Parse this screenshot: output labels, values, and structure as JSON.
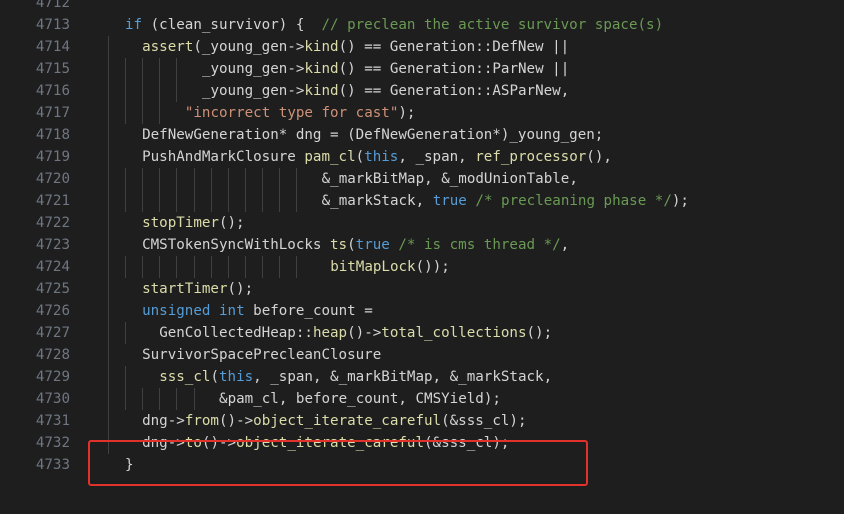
{
  "editor": {
    "first_line": 4712,
    "lines": [
      {
        "num": "4712",
        "indent": 0,
        "tokens": []
      },
      {
        "num": "4713",
        "indent": 0,
        "tokens": [
          {
            "t": "kw",
            "v": "if"
          },
          {
            "t": "plain",
            "v": " (clean_survivor) {  "
          },
          {
            "t": "cm",
            "v": "// preclean the active survivor space(s)"
          }
        ]
      },
      {
        "num": "4714",
        "indent": 2,
        "tokens": [
          {
            "t": "fn",
            "v": "assert"
          },
          {
            "t": "plain",
            "v": "(_young_gen->"
          },
          {
            "t": "fn",
            "v": "kind"
          },
          {
            "t": "plain",
            "v": "() == Generation::DefNew ||"
          }
        ]
      },
      {
        "num": "4715",
        "indent": 9,
        "tokens": [
          {
            "t": "plain",
            "v": "_young_gen->"
          },
          {
            "t": "fn",
            "v": "kind"
          },
          {
            "t": "plain",
            "v": "() == Generation::ParNew ||"
          }
        ]
      },
      {
        "num": "4716",
        "indent": 9,
        "tokens": [
          {
            "t": "plain",
            "v": "_young_gen->"
          },
          {
            "t": "fn",
            "v": "kind"
          },
          {
            "t": "plain",
            "v": "() == Generation::ASParNew,"
          }
        ]
      },
      {
        "num": "4717",
        "indent": 7,
        "tokens": [
          {
            "t": "str",
            "v": "\"incorrect type for cast\""
          },
          {
            "t": "plain",
            "v": ");"
          }
        ]
      },
      {
        "num": "4718",
        "indent": 2,
        "tokens": [
          {
            "t": "plain",
            "v": "DefNewGeneration* dng = (DefNewGeneration*)_young_gen;"
          }
        ]
      },
      {
        "num": "4719",
        "indent": 2,
        "tokens": [
          {
            "t": "plain",
            "v": "PushAndMarkClosure "
          },
          {
            "t": "fn",
            "v": "pam_cl"
          },
          {
            "t": "plain",
            "v": "("
          },
          {
            "t": "kw",
            "v": "this"
          },
          {
            "t": "plain",
            "v": ", _span, "
          },
          {
            "t": "fn",
            "v": "ref_processor"
          },
          {
            "t": "plain",
            "v": "(),"
          }
        ]
      },
      {
        "num": "4720",
        "indent": 23,
        "tokens": [
          {
            "t": "plain",
            "v": "&_markBitMap, &_modUnionTable,"
          }
        ]
      },
      {
        "num": "4721",
        "indent": 23,
        "tokens": [
          {
            "t": "plain",
            "v": "&_markStack, "
          },
          {
            "t": "kw",
            "v": "true"
          },
          {
            "t": "plain",
            "v": " "
          },
          {
            "t": "cm",
            "v": "/* precleaning phase */"
          },
          {
            "t": "plain",
            "v": ");"
          }
        ]
      },
      {
        "num": "4722",
        "indent": 2,
        "tokens": [
          {
            "t": "fn",
            "v": "stopTimer"
          },
          {
            "t": "plain",
            "v": "();"
          }
        ]
      },
      {
        "num": "4723",
        "indent": 2,
        "tokens": [
          {
            "t": "plain",
            "v": "CMSTokenSyncWithLocks "
          },
          {
            "t": "fn",
            "v": "ts"
          },
          {
            "t": "plain",
            "v": "("
          },
          {
            "t": "kw",
            "v": "true"
          },
          {
            "t": "plain",
            "v": " "
          },
          {
            "t": "cm",
            "v": "/* is cms thread */"
          },
          {
            "t": "plain",
            "v": ","
          }
        ]
      },
      {
        "num": "4724",
        "indent": 24,
        "tokens": [
          {
            "t": "fn",
            "v": "bitMapLock"
          },
          {
            "t": "plain",
            "v": "());"
          }
        ]
      },
      {
        "num": "4725",
        "indent": 2,
        "tokens": [
          {
            "t": "fn",
            "v": "startTimer"
          },
          {
            "t": "plain",
            "v": "();"
          }
        ]
      },
      {
        "num": "4726",
        "indent": 2,
        "tokens": [
          {
            "t": "kw",
            "v": "unsigned"
          },
          {
            "t": "plain",
            "v": " "
          },
          {
            "t": "kw",
            "v": "int"
          },
          {
            "t": "plain",
            "v": " before_count ="
          }
        ]
      },
      {
        "num": "4727",
        "indent": 4,
        "tokens": [
          {
            "t": "plain",
            "v": "GenCollectedHeap::"
          },
          {
            "t": "fn",
            "v": "heap"
          },
          {
            "t": "plain",
            "v": "()->"
          },
          {
            "t": "fn",
            "v": "total_collections"
          },
          {
            "t": "plain",
            "v": "();"
          }
        ]
      },
      {
        "num": "4728",
        "indent": 2,
        "tokens": [
          {
            "t": "plain",
            "v": "SurvivorSpacePrecleanClosure"
          }
        ]
      },
      {
        "num": "4729",
        "indent": 4,
        "tokens": [
          {
            "t": "fn",
            "v": "sss_cl"
          },
          {
            "t": "plain",
            "v": "("
          },
          {
            "t": "kw",
            "v": "this"
          },
          {
            "t": "plain",
            "v": ", _span, &_markBitMap, &_markStack,"
          }
        ]
      },
      {
        "num": "4730",
        "indent": 11,
        "tokens": [
          {
            "t": "plain",
            "v": "&pam_cl, before_count, CMSYield);"
          }
        ]
      },
      {
        "num": "4731",
        "indent": 2,
        "tokens": [
          {
            "t": "plain",
            "v": "dng->"
          },
          {
            "t": "fn",
            "v": "from"
          },
          {
            "t": "plain",
            "v": "()->"
          },
          {
            "t": "fn",
            "v": "object_iterate_careful"
          },
          {
            "t": "plain",
            "v": "(&sss_cl);"
          }
        ]
      },
      {
        "num": "4732",
        "indent": 2,
        "tokens": [
          {
            "t": "plain",
            "v": "dng->"
          },
          {
            "t": "fn",
            "v": "to"
          },
          {
            "t": "plain",
            "v": "()->"
          },
          {
            "t": "fn",
            "v": "object_iterate_careful"
          },
          {
            "t": "plain",
            "v": "(&sss_cl);"
          }
        ]
      },
      {
        "num": "4733",
        "indent": 0,
        "tokens": [
          {
            "t": "plain",
            "v": "}"
          }
        ]
      }
    ]
  },
  "colors": {
    "background": "#1e1e1e",
    "keyword": "#569cd6",
    "function": "#dcdcaa",
    "string": "#ce9178",
    "comment": "#6a9955",
    "highlight_box": "#e0322b"
  }
}
